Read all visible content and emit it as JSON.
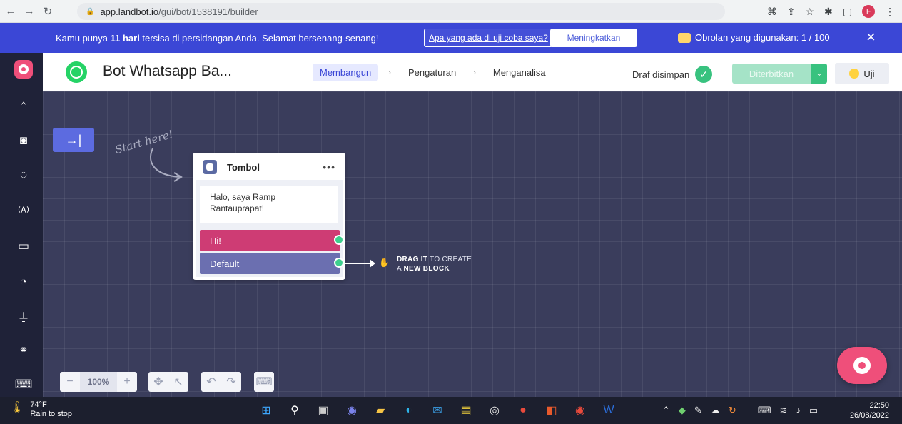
{
  "browser": {
    "url_host": "app.landbot.io",
    "url_path": "/gui/bot/1538191/builder",
    "profile_initial": "F"
  },
  "banner": {
    "text_before": "Kamu punya ",
    "days_bold": "11 hari",
    "text_after": " tersisa di persidangan Anda. Selamat bersenang-senang!",
    "trial_link": "Apa yang ada di uji coba saya?",
    "upgrade_label": "Meningkatkan",
    "chats_label": "Obrolan yang digunakan: 1 / 100",
    "close_icon": "×"
  },
  "header": {
    "bot_name": "Bot Whatsapp Ba...",
    "tabs": [
      {
        "label": "Membangun",
        "active": true
      },
      {
        "label": "Pengaturan",
        "active": false
      },
      {
        "label": "Menganalisa",
        "active": false
      }
    ],
    "draft_status": "Draf disimpan",
    "publish_label": "Diterbitkan",
    "test_label": "Uji"
  },
  "sidebar": {
    "icons": [
      "home-icon",
      "bot-icon",
      "whatsapp-icon",
      "broadcast-icon",
      "chat-icon",
      "analytics-icon",
      "plug-icon",
      "handshake-icon",
      "keyboard-icon"
    ]
  },
  "canvas": {
    "start_here": "Start here!",
    "block": {
      "title": "Tombol",
      "more": "•••",
      "message": "Halo, saya Ramp Rantauprapat!",
      "buttons": [
        {
          "label": "Hi!",
          "color": "#ce3c74"
        },
        {
          "label": "Default",
          "color": "#6b6fb0"
        }
      ]
    },
    "drag_hint_bold1": "DRAG IT",
    "drag_hint_1": " TO CREATE",
    "drag_hint_2": "A ",
    "drag_hint_bold2": "NEW BLOCK"
  },
  "zoom": {
    "minus": "−",
    "value": "100%",
    "plus": "+"
  },
  "taskbar": {
    "temperature": "74°F",
    "weather": "Rain to stop",
    "time": "22:50",
    "date": "26/08/2022"
  },
  "colors": {
    "brand": "#3b47d6",
    "accent_pink": "#ef4f7a",
    "success": "#38c27f",
    "canvas": "#3a3d5c"
  }
}
